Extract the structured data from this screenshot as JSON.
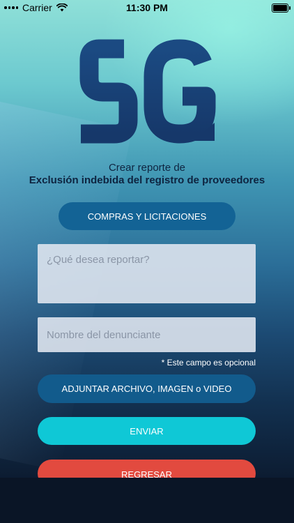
{
  "status_bar": {
    "carrier": "Carrier",
    "time": "11:30 PM"
  },
  "logo": {
    "letters": "SG"
  },
  "heading": {
    "subtitle": "Crear reporte de",
    "title": "Exclusión indebida del registro de proveedores"
  },
  "category_button": {
    "label": "COMPRAS Y LICITACIONES"
  },
  "report_field": {
    "placeholder": "¿Qué desea reportar?",
    "value": ""
  },
  "name_field": {
    "placeholder": "Nombre del denunciante",
    "value": ""
  },
  "optional_hint": "* Este campo es opcional",
  "attach_button": {
    "label": "ADJUNTAR ARCHIVO, IMAGEN o VIDEO"
  },
  "send_button": {
    "label": "ENVIAR"
  },
  "back_button": {
    "label": "REGRESAR"
  },
  "colors": {
    "primary_blue": "#136395",
    "send_cyan": "#0fc8d6",
    "back_red": "#e24a3f",
    "heading_text": "#0e2440"
  }
}
